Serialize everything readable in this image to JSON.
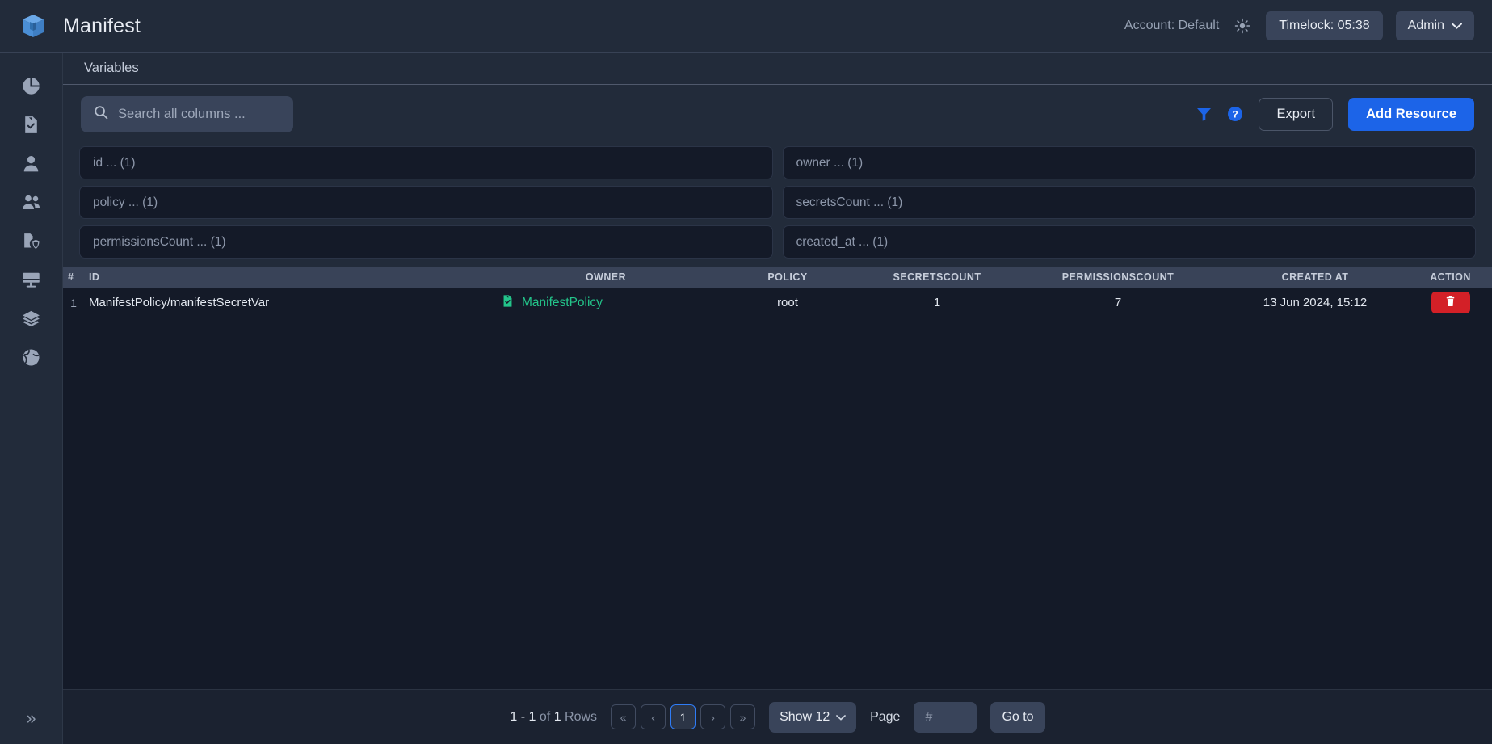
{
  "header": {
    "logo_icon": "manifest-cube-logo",
    "title": "Manifest",
    "account": "Account: Default",
    "theme_icon": "sun-icon",
    "timelock": "Timelock: 05:38",
    "admin_label": "Admin",
    "admin_chevron_icon": "chevron-down-icon"
  },
  "sidebar": {
    "items": [
      {
        "icon": "pie-chart-icon",
        "name": "dashboard"
      },
      {
        "icon": "document-check-icon",
        "name": "policies"
      },
      {
        "icon": "user-icon",
        "name": "user"
      },
      {
        "icon": "users-group-icon",
        "name": "groups"
      },
      {
        "icon": "shield-lock-icon",
        "name": "security"
      },
      {
        "icon": "monitor-icon",
        "name": "hosts"
      },
      {
        "icon": "layers-icon",
        "name": "layers"
      },
      {
        "icon": "globe-icon",
        "name": "network"
      }
    ],
    "expand_icon": "double-chevron-right-icon",
    "expand_label": "»"
  },
  "panel": {
    "title": "Variables"
  },
  "toolbar": {
    "search_placeholder": "Search all columns ...",
    "search_value": "",
    "search_icon": "search-icon",
    "filter_icon": "filter-icon",
    "help_icon": "help-circle-icon",
    "export_label": "Export",
    "add_resource_label": "Add Resource"
  },
  "filters": [
    {
      "placeholder": "id ... (1)",
      "value": ""
    },
    {
      "placeholder": "owner ... (1)",
      "value": ""
    },
    {
      "placeholder": "policy ... (1)",
      "value": ""
    },
    {
      "placeholder": "secretsCount ... (1)",
      "value": ""
    },
    {
      "placeholder": "permissionsCount ... (1)",
      "value": ""
    },
    {
      "placeholder": "created_at ... (1)",
      "value": ""
    }
  ],
  "table": {
    "columns": [
      "#",
      "ID",
      "OWNER",
      "POLICY",
      "SECRETSCOUNT",
      "PERMISSIONSCOUNT",
      "CREATED AT",
      "ACTION"
    ],
    "rows": [
      {
        "index": "1",
        "id": "ManifestPolicy/manifestSecretVar",
        "owner": "ManifestPolicy",
        "owner_icon": "document-check-icon",
        "policy": "root",
        "secretsCount": "1",
        "permissionsCount": "7",
        "created_at": "13 Jun 2024, 15:12",
        "action_icon": "trash-icon"
      }
    ]
  },
  "footer": {
    "range": "1 - 1",
    "of": "of",
    "total": "1",
    "rows_word": "Rows",
    "first_icon": "«",
    "prev_icon": "‹",
    "current_page": "1",
    "next_icon": "›",
    "last_icon": "»",
    "show_label": "Show 12",
    "show_chevron_icon": "chevron-down-icon",
    "page_label": "Page",
    "page_placeholder": "#",
    "page_value": "",
    "goto_label": "Go to"
  },
  "colors": {
    "accent": "#1c64e8",
    "danger": "#d32027",
    "success": "#23c48a",
    "header_bg": "#222b3a",
    "body_bg": "#141a28",
    "table_head_bg": "#394358"
  }
}
